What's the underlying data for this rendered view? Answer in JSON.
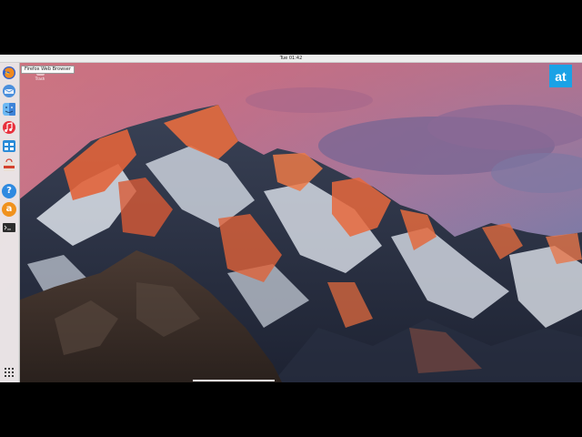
{
  "menubar": {
    "apple_symbol": "",
    "clock": "Tue 01:42"
  },
  "dock": {
    "items": [
      {
        "icon": "firefox-icon",
        "tooltip": "Firefox Web Browser"
      },
      {
        "icon": "mail-icon"
      },
      {
        "icon": "finder-icon"
      },
      {
        "icon": "music-icon"
      },
      {
        "icon": "calendar-icon"
      },
      {
        "icon": "software-store-icon"
      },
      {
        "icon": "help-icon",
        "glyph": "?"
      },
      {
        "icon": "amazon-icon",
        "glyph": "a"
      },
      {
        "icon": "terminal-icon"
      }
    ],
    "app_grid_icon": "app-grid-icon"
  },
  "tooltip": "Firefox Web Browser",
  "desktop_icon": {
    "label": "Trash"
  },
  "brand_logo": {
    "text": "at",
    "color": "#1aa2e6"
  },
  "colors": {
    "sky_top": "#c06f86",
    "sky_right": "#7d6e9c",
    "mountain_shadow": "#2c3547",
    "snow": "#e6eaf0",
    "alpenglow": "#e0643c",
    "dock_bg": "#ebebeb"
  }
}
